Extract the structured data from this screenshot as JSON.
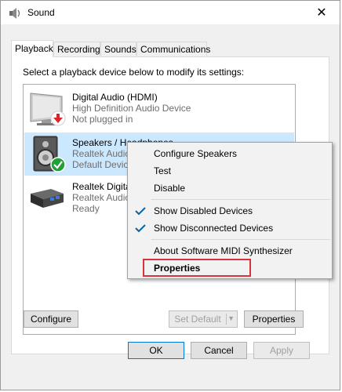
{
  "window": {
    "title": "Sound",
    "close_symbol": "✕"
  },
  "tabs": [
    {
      "label": "Playback",
      "active": true
    },
    {
      "label": "Recording",
      "active": false
    },
    {
      "label": "Sounds",
      "active": false
    },
    {
      "label": "Communications",
      "active": false
    }
  ],
  "instruction": "Select a playback device below to modify its settings:",
  "devices": [
    {
      "name": "Digital Audio (HDMI)",
      "line1": "High Definition Audio Device",
      "line2": "Not plugged in",
      "icon": "monitor-icon",
      "badge": "red-down-arrow-icon",
      "selected": false
    },
    {
      "name": "Speakers / Headphones",
      "line1": "Realtek Audio",
      "line2": "Default Device",
      "icon": "speaker-icon",
      "badge": "green-check-icon",
      "selected": true
    },
    {
      "name": "Realtek Digital Output",
      "line1": "Realtek Audio",
      "line2": "Ready",
      "icon": "digital-output-icon",
      "badge": "",
      "selected": false
    }
  ],
  "buttons": {
    "configure": "Configure",
    "set_default": "Set Default",
    "properties": "Properties",
    "ok": "OK",
    "cancel": "Cancel",
    "apply": "Apply"
  },
  "context_menu": {
    "items": [
      {
        "label": "Configure Speakers",
        "checked": false
      },
      {
        "label": "Test",
        "checked": false
      },
      {
        "label": "Disable",
        "checked": false
      },
      {
        "label": "Show Disabled Devices",
        "checked": true
      },
      {
        "label": "Show Disconnected Devices",
        "checked": true
      },
      {
        "label": "About Software MIDI Synthesizer",
        "checked": false
      },
      {
        "label": "Properties",
        "checked": false,
        "bold": true
      }
    ]
  },
  "colors": {
    "selection": "#cce8ff",
    "check": "#0a64a4",
    "highlight_border": "#d9323b",
    "accent": "#0078d7"
  }
}
